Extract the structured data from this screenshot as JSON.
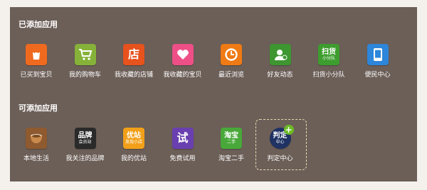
{
  "added": {
    "title": "已添加应用",
    "apps": [
      {
        "label": "已买到宝贝",
        "icon": "shopping-bag-icon",
        "color": "#ef6a1f"
      },
      {
        "label": "我的购物车",
        "icon": "shopping-cart-icon",
        "color": "#86b23a"
      },
      {
        "label": "我收藏的店铺",
        "icon": "store-icon",
        "color": "#e8521d",
        "tile": "店"
      },
      {
        "label": "我收藏的宝贝",
        "icon": "heart-icon",
        "color": "#ee4f86"
      },
      {
        "label": "最近浏览",
        "icon": "clock-icon",
        "color": "#f07a14"
      },
      {
        "label": "好友动态",
        "icon": "friend-icon",
        "color": "#3e9630"
      },
      {
        "label": "扫货小分队",
        "icon": "shopping-team-icon",
        "color": "#3d9d2e",
        "tile": "扫货",
        "tile_sub": "小分队"
      },
      {
        "label": "便民中心",
        "icon": "phone-icon",
        "color": "#2d86d9"
      }
    ]
  },
  "addable": {
    "title": "可添加应用",
    "apps": [
      {
        "label": "本地生活",
        "icon": "coffee-cup-icon",
        "color": "#8f5a2f"
      },
      {
        "label": "我关注的品牌",
        "icon": "brand-icon",
        "color": "#2a2a2a",
        "tile": "品牌",
        "tile_sub": "会员站"
      },
      {
        "label": "我的优站",
        "icon": "youzhan-icon",
        "color": "#f2a019",
        "tile": "优站",
        "tile_sub": "发现小店"
      },
      {
        "label": "免费试用",
        "icon": "trial-icon",
        "color": "#6a3fb0",
        "tile": "试"
      },
      {
        "label": "淘宝二手",
        "icon": "secondhand-icon",
        "color": "#49a83a",
        "tile": "淘宝",
        "tile_sub": "二手"
      },
      {
        "label": "判定中心",
        "icon": "judgement-icon",
        "color": "#1f3263",
        "tile": "判定",
        "tile_sub": "中心",
        "selected": true,
        "badge": "+"
      }
    ]
  }
}
